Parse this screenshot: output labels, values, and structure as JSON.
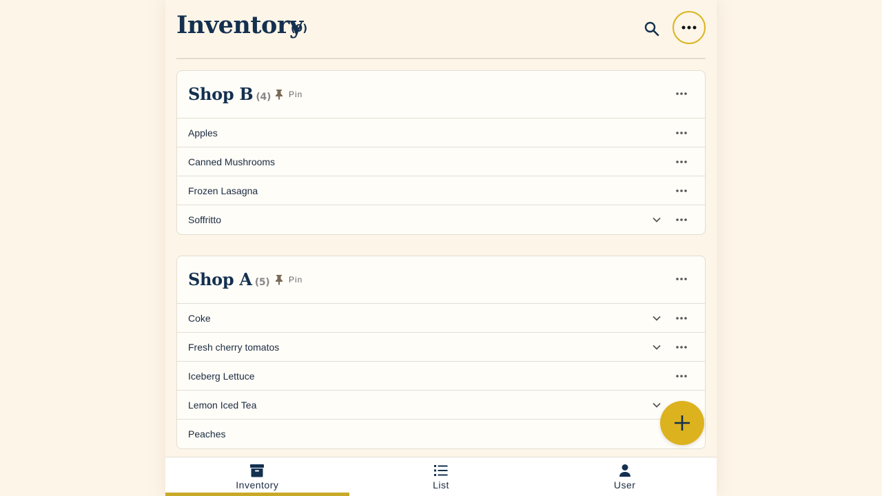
{
  "header": {
    "title": "Inventory",
    "count": "(9)"
  },
  "icons": {
    "search": "search-icon",
    "more": "more-horizontal-icon",
    "pin": "pin-icon",
    "chevron": "chevron-down-icon",
    "add": "plus-icon"
  },
  "colors": {
    "accent": "#dcb21e",
    "navy": "#13304f",
    "background": "#fdf5e8"
  },
  "shops": [
    {
      "name": "Shop B",
      "count": "(4)",
      "pin_label": "Pin",
      "items": [
        {
          "label": "Apples",
          "expandable": false
        },
        {
          "label": "Canned Mushrooms",
          "expandable": false
        },
        {
          "label": "Frozen Lasagna",
          "expandable": false
        },
        {
          "label": "Soffritto",
          "expandable": true
        }
      ]
    },
    {
      "name": "Shop A",
      "count": "(5)",
      "pin_label": "Pin",
      "items": [
        {
          "label": "Coke",
          "expandable": true
        },
        {
          "label": "Fresh cherry tomatos",
          "expandable": true
        },
        {
          "label": "Iceberg Lettuce",
          "expandable": false
        },
        {
          "label": "Lemon Iced Tea",
          "expandable": true
        },
        {
          "label": "Peaches",
          "expandable": false
        }
      ]
    }
  ],
  "nav": {
    "items": [
      {
        "label": "Inventory",
        "icon": "archive-icon",
        "active": true
      },
      {
        "label": "List",
        "icon": "list-icon",
        "active": false
      },
      {
        "label": "User",
        "icon": "user-icon",
        "active": false
      }
    ]
  }
}
